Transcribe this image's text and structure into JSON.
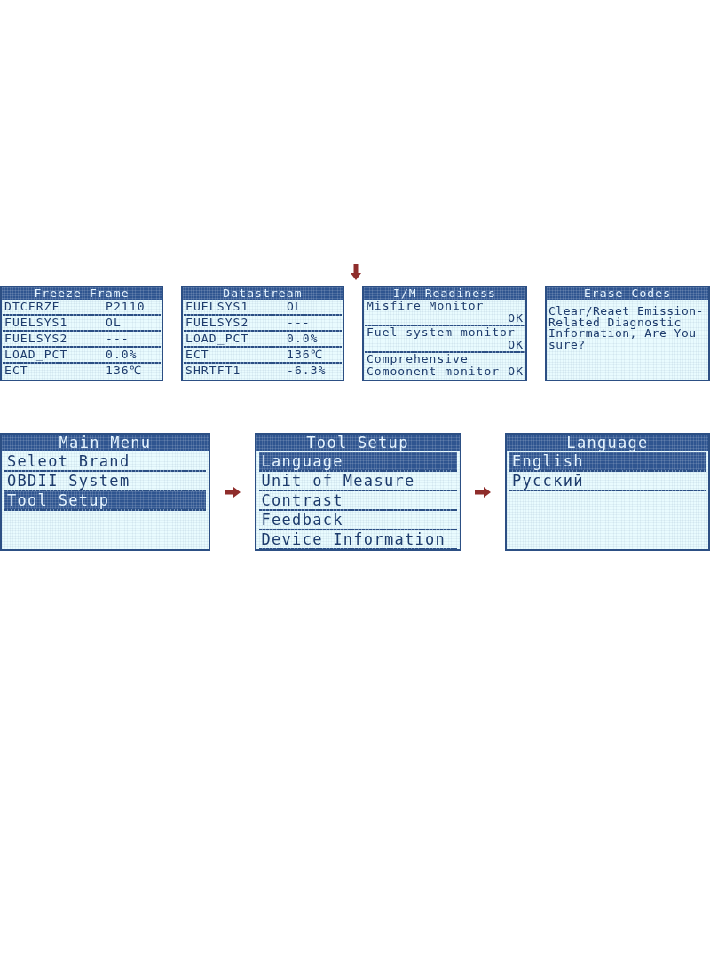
{
  "top_row": {
    "screens": [
      {
        "kind": "table",
        "title": "Freeze Frame",
        "rows": [
          {
            "name": "DTCFRZF",
            "value": "P2110"
          },
          {
            "name": "FUELSYS1",
            "value": "OL"
          },
          {
            "name": "FUELSYS2",
            "value": "---"
          },
          {
            "name": "LOAD_PCT",
            "value": "0.0%"
          },
          {
            "name": "ECT",
            "value": "136℃"
          }
        ]
      },
      {
        "kind": "table",
        "title": "Datastream",
        "rows": [
          {
            "name": "FUELSYS1",
            "value": "OL"
          },
          {
            "name": "FUELSYS2",
            "value": "---"
          },
          {
            "name": "LOAD_PCT",
            "value": "0.0%"
          },
          {
            "name": "ECT",
            "value": "136℃"
          },
          {
            "name": "SHRTFT1",
            "value": "-6.3%"
          }
        ]
      },
      {
        "kind": "monitors",
        "title": "I/M Readiness",
        "items": [
          {
            "name": "Misfire Monitor",
            "status": "OK"
          },
          {
            "name": "Fuel system monitor",
            "status": "OK"
          },
          {
            "name": "Comprehensive Comoonent monitor",
            "status": "OK"
          }
        ]
      },
      {
        "kind": "message",
        "title": "Erase Codes",
        "text": "Clear/Reaet Emission-Related Diagnostic Information, Are You sure?"
      }
    ]
  },
  "bottom_row": {
    "screens": [
      {
        "kind": "menu",
        "title": "Main Menu",
        "items": [
          {
            "label": "Seleot Brand",
            "selected": false
          },
          {
            "label": "OBDII System",
            "selected": false
          },
          {
            "label": "Tool Setup",
            "selected": true
          }
        ]
      },
      {
        "kind": "menu",
        "title": "Tool Setup",
        "items": [
          {
            "label": "Language",
            "selected": true
          },
          {
            "label": "Unit of Measure",
            "selected": false
          },
          {
            "label": "Contrast",
            "selected": false
          },
          {
            "label": "Feedback",
            "selected": false
          },
          {
            "label": "Device Information",
            "selected": false
          }
        ]
      },
      {
        "kind": "menu",
        "title": "Language",
        "items": [
          {
            "label": "English",
            "selected": true
          },
          {
            "label": "Русский",
            "selected": false
          }
        ]
      }
    ]
  }
}
